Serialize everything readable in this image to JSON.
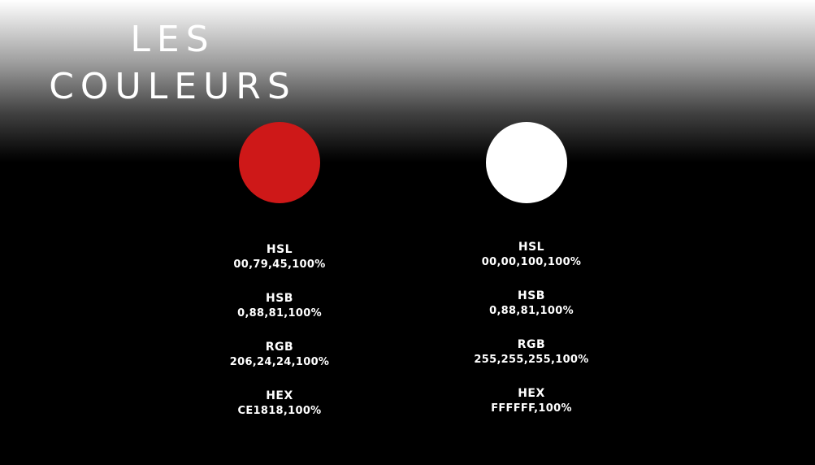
{
  "title": {
    "line1": "LES",
    "line2": "COULEURS"
  },
  "colors": [
    {
      "swatch_color": "#CE1818",
      "hsl_label": "HSL",
      "hsl_value": "00,79,45,100%",
      "hsb_label": "HSB",
      "hsb_value": "0,88,81,100%",
      "rgb_label": "RGB",
      "rgb_value": "206,24,24,100%",
      "hex_label": "HEX",
      "hex_value": "CE1818,100%"
    },
    {
      "swatch_color": "#FFFFFF",
      "hsl_label": "HSL",
      "hsl_value": "00,00,100,100%",
      "hsb_label": "HSB",
      "hsb_value": "0,88,81,100%",
      "rgb_label": "RGB",
      "rgb_value": "255,255,255,100%",
      "hex_label": "HEX",
      "hex_value": "FFFFFF,100%"
    }
  ]
}
